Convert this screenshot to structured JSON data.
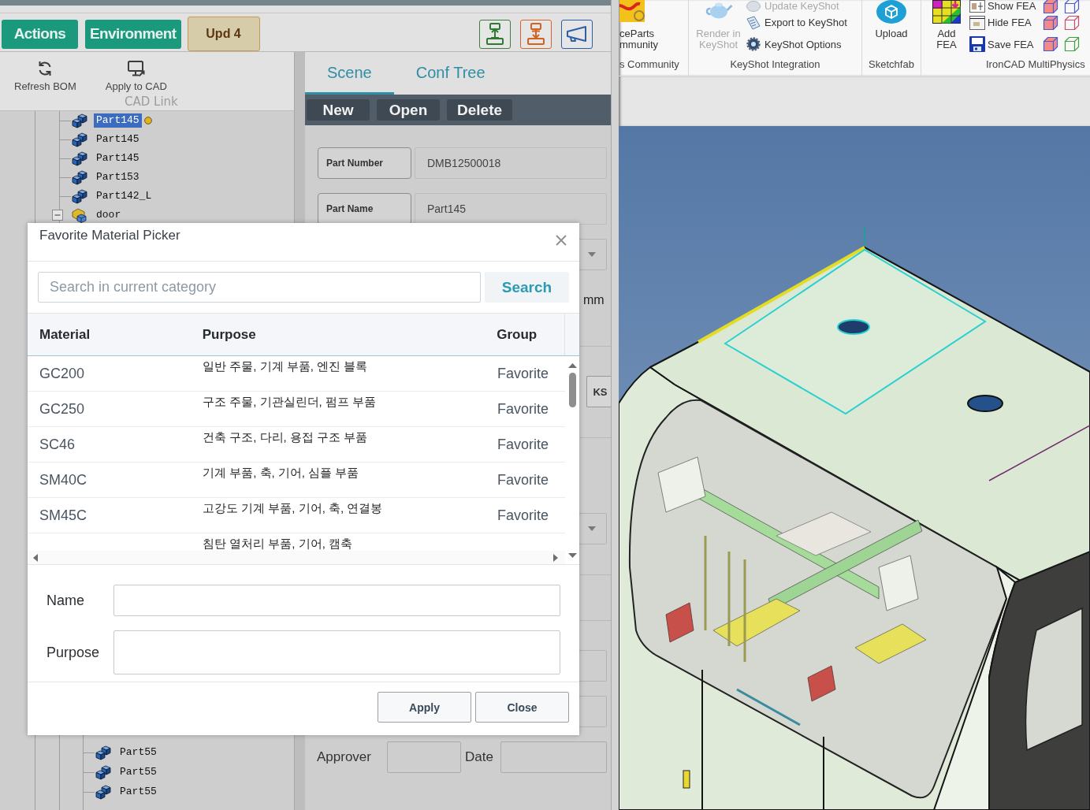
{
  "left_app": {
    "header_buttons": [
      {
        "label": "Actions",
        "kind": "primary"
      },
      {
        "label": "Environment",
        "kind": "primary"
      },
      {
        "label": "Upd 4",
        "kind": "notice"
      }
    ],
    "ribbon": {
      "buttons": [
        "Refresh BOM",
        "Apply to CAD"
      ],
      "group_label": "CAD Link"
    },
    "tree": [
      {
        "label": "Part145",
        "kind": "part",
        "selected": true,
        "marked": true
      },
      {
        "label": "Part145",
        "kind": "part",
        "selected": false,
        "marked": false
      },
      {
        "label": "Part145",
        "kind": "part",
        "selected": false,
        "marked": false
      },
      {
        "label": "Part153",
        "kind": "part",
        "selected": false,
        "marked": false
      },
      {
        "label": "Part142_L",
        "kind": "part",
        "selected": false,
        "marked": false
      },
      {
        "label": "door",
        "kind": "assembly",
        "selected": false,
        "marked": false,
        "expanded": true,
        "children": [
          {
            "label": "Part55",
            "kind": "part",
            "selected": false,
            "marked": false
          },
          {
            "label": "Part55",
            "kind": "part",
            "selected": false,
            "marked": false
          },
          {
            "label": "Part55",
            "kind": "part",
            "selected": false,
            "marked": false
          }
        ]
      }
    ]
  },
  "scene_panel": {
    "tabs": [
      {
        "label": "Scene",
        "selected": true
      },
      {
        "label": "Conf Tree",
        "selected": false
      }
    ],
    "toolbar": [
      "New",
      "Open",
      "Delete"
    ],
    "fields": [
      {
        "label": "Part Number",
        "value": "DMB12500018"
      },
      {
        "label": "Part Name",
        "value": "Part145"
      }
    ],
    "covered_rows": [
      {
        "kind": "select"
      },
      {
        "kind": "unit",
        "text": "mm"
      },
      {
        "kind": "divider"
      },
      {
        "kind": "button",
        "text": "KS"
      },
      {
        "kind": "divider"
      },
      {
        "kind": "blank"
      },
      {
        "kind": "select"
      },
      {
        "kind": "divider"
      },
      {
        "kind": "divider"
      },
      {
        "kind": "field"
      },
      {
        "kind": "field"
      }
    ],
    "approval": {
      "approver_label": "Approver",
      "date_label": "Date"
    }
  },
  "dialog": {
    "title": "Favorite Material Picker",
    "search": {
      "placeholder": "Search in current category",
      "button": "Search"
    },
    "table": {
      "columns": [
        "Material",
        "Purpose",
        "Group"
      ],
      "rows": [
        {
          "material": "GC200",
          "purpose": "일반 주물, 기계 부품, 엔진 블록",
          "group": "Favorite"
        },
        {
          "material": "GC250",
          "purpose": "구조 주물, 기관실린더, 펌프 부품",
          "group": "Favorite"
        },
        {
          "material": "SC46",
          "purpose": "건축 구조, 다리, 용접 구조 부품",
          "group": "Favorite"
        },
        {
          "material": "SM40C",
          "purpose": "기계 부품, 축, 기어, 심플 부품",
          "group": "Favorite"
        },
        {
          "material": "SM45C",
          "purpose": "고강도 기계 부품, 기어, 축, 연결봉",
          "group": "Favorite"
        },
        {
          "purpose": "침탄 열처리 부품, 기어, 캠축"
        }
      ]
    },
    "form": [
      {
        "label": "Name",
        "kind": "line"
      },
      {
        "label": "Purpose",
        "kind": "area"
      }
    ],
    "buttons": [
      "Apply",
      "Close"
    ]
  },
  "cad_window": {
    "ribbon_groups": [
      {
        "label": "s Community",
        "large": [
          {
            "label": "ceParts\nmmunity",
            "disabled": false
          }
        ]
      },
      {
        "label": "KeyShot Integration",
        "large": [
          {
            "label": "Render in\nKeyShot",
            "disabled": true
          }
        ],
        "small": [
          {
            "label": "Update KeyShot",
            "disabled": true
          },
          {
            "label": "Export to KeyShot",
            "disabled": false
          },
          {
            "label": "KeyShot Options",
            "disabled": false
          }
        ]
      },
      {
        "label": "Sketchfab",
        "large": [
          {
            "label": "Upload",
            "disabled": false
          }
        ]
      },
      {
        "label": "IronCAD MultiPhysics",
        "large": [
          {
            "label": "Add\nFEA",
            "disabled": false
          }
        ],
        "small": [
          {
            "label": "Show FEA",
            "disabled": false
          },
          {
            "label": "Hide FEA",
            "disabled": false
          },
          {
            "label": "Save FEA",
            "disabled": false
          }
        ]
      }
    ]
  }
}
